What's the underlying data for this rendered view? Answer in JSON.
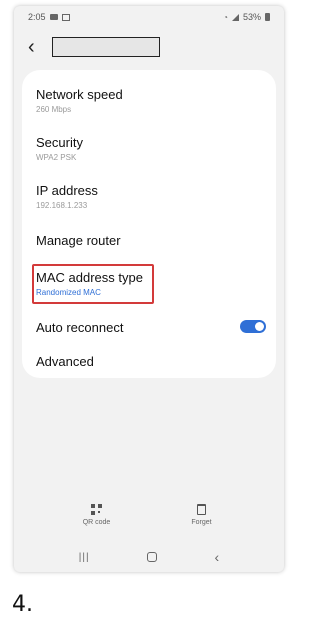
{
  "status_bar": {
    "time": "2:05",
    "battery": "53%"
  },
  "header": {
    "title": ""
  },
  "settings": [
    {
      "title": "Network speed",
      "subtitle": "260 Mbps"
    },
    {
      "title": "Security",
      "subtitle": "WPA2 PSK"
    },
    {
      "title": "IP address",
      "subtitle": "192.168.1.233"
    },
    {
      "title": "Manage router"
    },
    {
      "title": "MAC address type",
      "subtitle": "Randomized MAC"
    },
    {
      "title": "Auto reconnect",
      "toggle_on": true
    },
    {
      "title": "Advanced"
    }
  ],
  "bottom_actions": {
    "qr_label": "QR code",
    "forget_label": "Forget"
  },
  "step_label": "4.",
  "colors": {
    "accent": "#2f6fd6",
    "highlight": "#d33a3a",
    "background": "#f2f2f2"
  }
}
